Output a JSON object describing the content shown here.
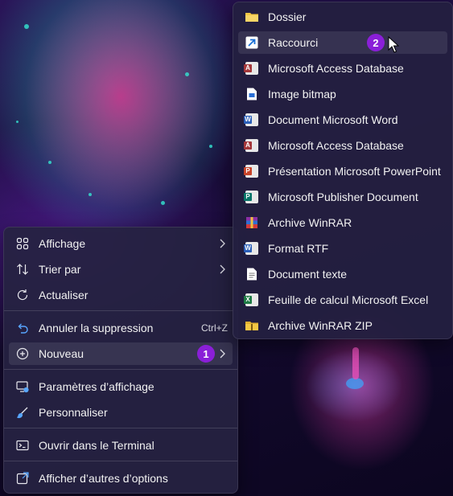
{
  "context_menu": {
    "items": [
      {
        "label": "Affichage",
        "icon": "grid-view-icon"
      },
      {
        "label": "Trier par",
        "icon": "sort-icon"
      },
      {
        "label": "Actualiser",
        "icon": "refresh-icon"
      },
      {
        "label": "Annuler la suppression",
        "icon": "undo-icon",
        "shortcut": "Ctrl+Z"
      },
      {
        "label": "Nouveau",
        "icon": "new-plus-icon",
        "badge": "1"
      },
      {
        "label": "Paramètres d’affichage",
        "icon": "display-settings-icon"
      },
      {
        "label": "Personnaliser",
        "icon": "brush-icon"
      },
      {
        "label": "Ouvrir dans le Terminal",
        "icon": "terminal-icon"
      },
      {
        "label": "Afficher d’autres d’options",
        "icon": "more-options-icon"
      }
    ]
  },
  "submenu": {
    "items": [
      {
        "label": "Dossier",
        "icon": "folder-icon"
      },
      {
        "label": "Raccourci",
        "icon": "shortcut-icon",
        "badge": "2"
      },
      {
        "label": "Microsoft Access Database",
        "icon": "access-icon"
      },
      {
        "label": "Image bitmap",
        "icon": "bitmap-icon"
      },
      {
        "label": "Document Microsoft Word",
        "icon": "word-icon"
      },
      {
        "label": "Microsoft Access Database",
        "icon": "access-icon"
      },
      {
        "label": "Présentation Microsoft PowerPoint",
        "icon": "powerpoint-icon"
      },
      {
        "label": "Microsoft Publisher Document",
        "icon": "publisher-icon"
      },
      {
        "label": "Archive WinRAR",
        "icon": "winrar-icon"
      },
      {
        "label": "Format RTF",
        "icon": "rtf-icon"
      },
      {
        "label": "Document texte",
        "icon": "text-document-icon"
      },
      {
        "label": "Feuille de calcul Microsoft Excel",
        "icon": "excel-icon"
      },
      {
        "label": "Archive WinRAR ZIP",
        "icon": "winrar-zip-icon"
      }
    ]
  },
  "colors": {
    "badge": "#8a1fd8",
    "menu_bg": "#26224a",
    "word": "#2b5fb8",
    "excel": "#1e7a45",
    "powerpoint": "#c7442a",
    "access": "#a4373a",
    "publisher": "#077568",
    "folder": "#f3c744"
  }
}
